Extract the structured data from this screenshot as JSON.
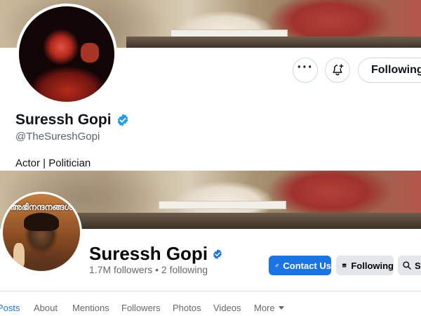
{
  "x_profile": {
    "name": "Suressh Gopi",
    "handle": "@TheSureshGopi",
    "bio": "Actor | Politician",
    "following_label": "Following",
    "icons": {
      "more": "more-horizontal-icon",
      "notify": "bell-plus-icon",
      "verified": "verified-badge-icon"
    },
    "colors": {
      "verified": "#1d9bf0",
      "text": "#0f1419",
      "muted": "#536471"
    }
  },
  "fb_profile": {
    "name": "Suressh Gopi",
    "stats": "1.7M followers • 2 following",
    "avatar_title": "അഭിനന്ദനങ്ങൾ",
    "buttons": {
      "contact": "Contact Us",
      "following": "Following",
      "search": "S"
    },
    "tabs": [
      {
        "label": "Posts",
        "active": true
      },
      {
        "label": "About"
      },
      {
        "label": "Mentions"
      },
      {
        "label": "Followers"
      },
      {
        "label": "Photos"
      },
      {
        "label": "Videos"
      },
      {
        "label": "More"
      }
    ],
    "icons": {
      "verified": "verified-badge-icon",
      "contact": "link-icon",
      "following": "inbox-icon",
      "search": "search-icon",
      "more": "caret-down-icon"
    },
    "colors": {
      "primary": "#1b74e4",
      "secondary_bg": "#e4e6eb",
      "muted": "#65676b"
    }
  }
}
